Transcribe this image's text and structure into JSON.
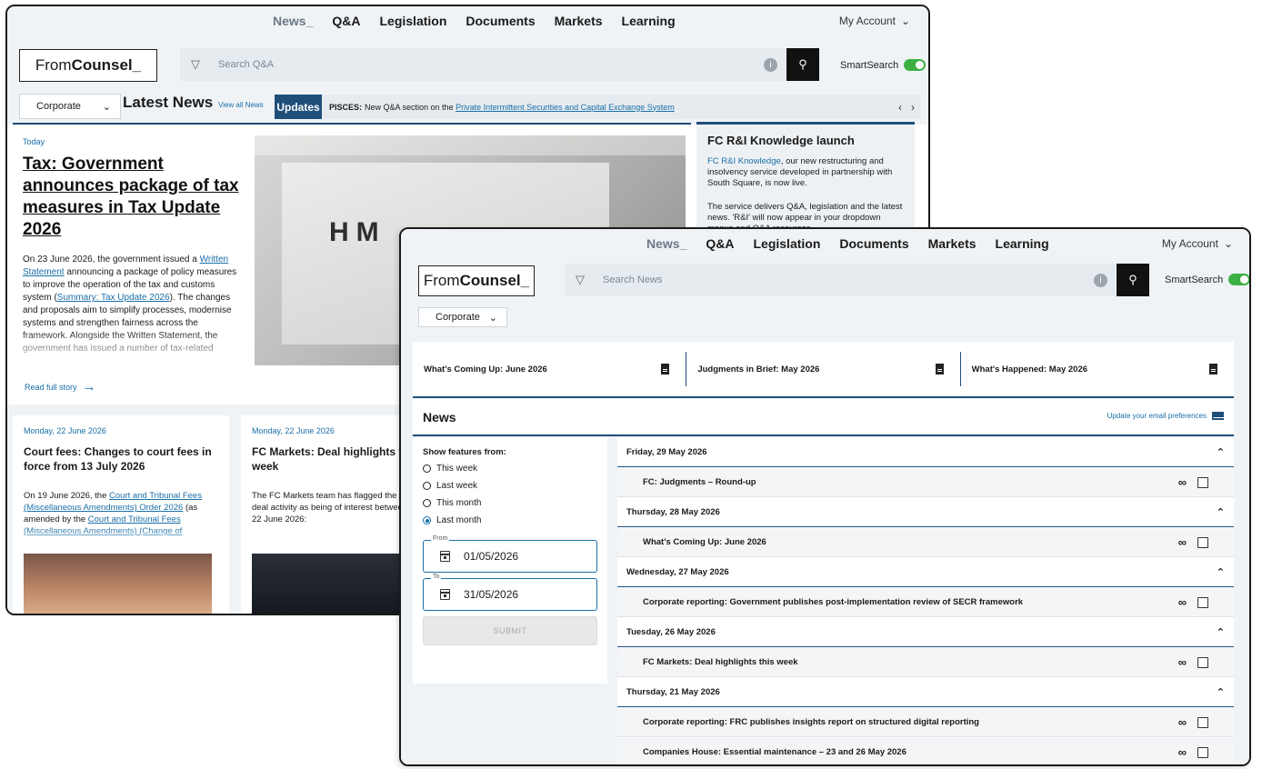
{
  "nav": {
    "items": [
      "News_",
      "Q&A",
      "Legislation",
      "Documents",
      "Markets",
      "Learning"
    ],
    "account": "My Account"
  },
  "brand": {
    "logo_light": "From",
    "logo_bold": "Counsel_"
  },
  "back": {
    "search_placeholder": "Search Q&A",
    "smartsearch": "SmartSearch",
    "practice_area": "Corporate",
    "latest_news": "Latest News",
    "view_all": "View all News",
    "updates": "Updates",
    "ticker": {
      "label": "PISCES:",
      "text": "New Q&A section on the",
      "link": "Private Intermittent Securities and Capital Exchange System"
    },
    "hero": {
      "date": "Today",
      "title": "Tax: Government announces package of tax measures in Tax Update 2026",
      "body": {
        "p1": "On 23 June 2026, the government issued a",
        "link1": "Written Statement",
        "p2": "announcing a package of policy measures to improve the operation of the tax and customs system (",
        "link2": "Summary: Tax Update 2026",
        "p3": "). The changes and proposals aim to simplify processes, modernise systems and strengthen fairness across the framework. Alongside the Written Statement, the government has issued a number of tax-related"
      },
      "read_full": "Read full story",
      "image_text": "HM"
    },
    "side": {
      "title": "FC R&I Knowledge launch",
      "link": "FC R&I Knowledge",
      "p1": ", our new restructuring and insolvency service developed in partnership with South Square, is now live.",
      "p2": "The service delivers Q&A, legislation and the latest news. 'R&I' will now appear in your dropdown menus and Q&A resources."
    },
    "cards": [
      {
        "date": "Monday, 22 June 2026",
        "title": "Court fees: Changes to court fees in force from 13 July 2026",
        "b1": "On 19 June 2026, the",
        "l1": "Court and Tribunal Fees (Miscellaneous Amendments) Order 2026",
        "b2": "(as amended by the",
        "l2": "Court and Tribunal Fees (Miscellaneous Amendments) (Change of"
      },
      {
        "date": "Monday, 22 June 2026",
        "title": "FC Markets: Deal highlights this week",
        "b1": "The FC Markets team has flagged the following deal activity as being of interest between 16 and 22 June 2026:"
      }
    ]
  },
  "front": {
    "search_placeholder": "Search News",
    "smartsearch": "SmartSearch",
    "practice_area": "Corporate",
    "docs": [
      "What's Coming Up: June 2026",
      "Judgments in Brief: May 2026",
      "What's Happened: May 2026"
    ],
    "news_title": "News",
    "email_prefs": "Update your email preferences",
    "filter": {
      "label": "Show features from:",
      "options": [
        "This week",
        "Last week",
        "This month",
        "Last month"
      ],
      "selected": "Last month",
      "from_label": "From",
      "from_value": "01/05/2026",
      "to_label": "To",
      "to_value": "31/05/2026",
      "submit": "SUBMIT"
    },
    "groups": [
      {
        "day": "Friday, 29 May 2026",
        "articles": [
          "FC: Judgments – Round-up"
        ]
      },
      {
        "day": "Thursday, 28 May 2026",
        "articles": [
          "What's Coming Up: June 2026"
        ]
      },
      {
        "day": "Wednesday, 27 May 2026",
        "articles": [
          "Corporate reporting: Government publishes post-implementation review of SECR framework"
        ]
      },
      {
        "day": "Tuesday, 26 May 2026",
        "articles": [
          "FC Markets: Deal highlights this week"
        ]
      },
      {
        "day": "Thursday, 21 May 2026",
        "articles": [
          "Corporate reporting: FRC publishes insights report on structured digital reporting",
          "Companies House: Essential maintenance – 23 and 26 May 2026"
        ]
      }
    ]
  },
  "colors": {
    "navy": "#1f4e79",
    "link": "#1a6fa8",
    "toggle": "#3cb043",
    "panel": "#f0f3f6"
  },
  "icons": [
    "filter-icon",
    "info-icon",
    "search-icon",
    "chevron-down-icon",
    "chevron-left-icon",
    "chevron-right-icon",
    "arrow-right-icon",
    "document-icon",
    "envelope-icon",
    "calendar-icon",
    "link-icon",
    "checkbox-icon",
    "chevron-up-icon"
  ]
}
